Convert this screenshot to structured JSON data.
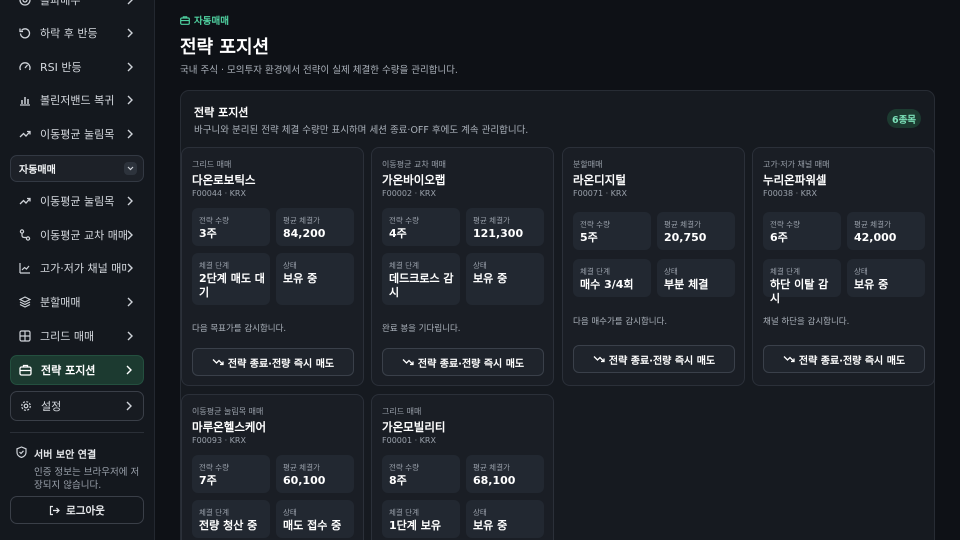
{
  "sidebar": {
    "top_items": [
      {
        "label": "돌파매수",
        "icon": "target-icon"
      },
      {
        "label": "하락 후 반등",
        "icon": "rotate-icon"
      },
      {
        "label": "RSI 반등",
        "icon": "gauge-icon"
      },
      {
        "label": "볼린저밴드 복귀",
        "icon": "bar-chart-icon"
      },
      {
        "label": "이동평균 눌림목",
        "icon": "trend-up-icon"
      }
    ],
    "section_label": "자동매매",
    "auto_items": [
      {
        "label": "이동평균 눌림목",
        "icon": "trend-up-icon"
      },
      {
        "label": "이동평균 교차 매매",
        "icon": "route-icon"
      },
      {
        "label": "고가·저가 채널 매매",
        "icon": "channel-chart-icon"
      },
      {
        "label": "분할매매",
        "icon": "layers-icon"
      },
      {
        "label": "그리드 매매",
        "icon": "grid-icon"
      },
      {
        "label": "전략 포지션",
        "icon": "briefcase-icon"
      }
    ],
    "settings_label": "설정",
    "secure_title": "서버 보안 연결",
    "secure_desc": "인증 정보는 브라우저에 저장되지 않습니다.",
    "logout_label": "로그아웃"
  },
  "header": {
    "crumb": "자동매매",
    "title": "전략 포지션",
    "subtitle": "국내 주식 · 모의투자 환경에서 전략이 실제 체결한 수량을 관리합니다."
  },
  "panel": {
    "title": "전략 포지션",
    "desc": "바구니와 분리된 전략 체결 수량만 표시하며 세션 종료·OFF 후에도 계속 관리합니다.",
    "count": "6종목",
    "labels": {
      "qty": "전략 수량",
      "avg": "평균 체결가",
      "stage": "체결 단계",
      "status": "상태"
    },
    "stop_label": "전략 종료·전량 즉시 매도"
  },
  "positions": [
    {
      "type": "그리드 매매",
      "name": "다온로보틱스",
      "code": "F00044 · KRX",
      "qty": "3주",
      "avg": "84,200",
      "stage": "2단계 매도 대기",
      "status": "보유 중",
      "note": "다음 목표가를 감시합니다."
    },
    {
      "type": "이동평균 교차 매매",
      "name": "가온바이오랩",
      "code": "F00002 · KRX",
      "qty": "4주",
      "avg": "121,300",
      "stage": "데드크로스 감시",
      "status": "보유 중",
      "note": "완료 봉을 기다립니다."
    },
    {
      "type": "분할매매",
      "name": "라온디지털",
      "code": "F00071 · KRX",
      "qty": "5주",
      "avg": "20,750",
      "stage": "매수 3/4회",
      "status": "부분 체결",
      "note": "다음 매수가를 감시합니다."
    },
    {
      "type": "고가·저가 채널 매매",
      "name": "누리온파워셀",
      "code": "F00038 · KRX",
      "qty": "6주",
      "avg": "42,000",
      "stage": "하단 이탈 감시",
      "status": "보유 중",
      "note": "채널 하단을 감시합니다."
    },
    {
      "type": "이동평균 눌림목 매매",
      "name": "마루온헬스케어",
      "code": "F00093 · KRX",
      "qty": "7주",
      "avg": "60,100",
      "stage": "전량 청산 중",
      "status": "매도 접수 중",
      "note": ""
    },
    {
      "type": "그리드 매매",
      "name": "가온모빌리티",
      "code": "F00001 · KRX",
      "qty": "8주",
      "avg": "68,100",
      "stage": "1단계 보유",
      "status": "보유 중",
      "note": ""
    }
  ]
}
